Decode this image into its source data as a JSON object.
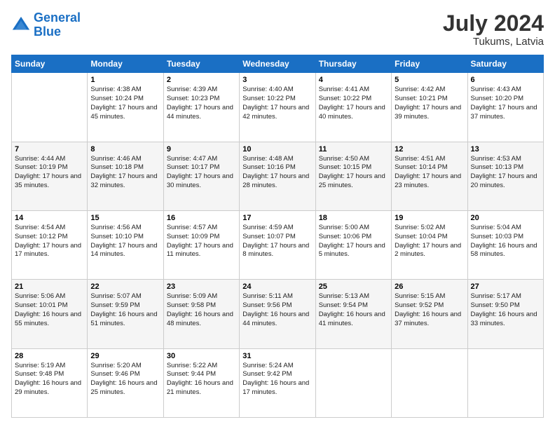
{
  "header": {
    "logo_line1": "General",
    "logo_line2": "Blue",
    "month_year": "July 2024",
    "location": "Tukums, Latvia"
  },
  "weekdays": [
    "Sunday",
    "Monday",
    "Tuesday",
    "Wednesday",
    "Thursday",
    "Friday",
    "Saturday"
  ],
  "weeks": [
    [
      {
        "day": "",
        "info": ""
      },
      {
        "day": "1",
        "info": "Sunrise: 4:38 AM\nSunset: 10:24 PM\nDaylight: 17 hours\nand 45 minutes."
      },
      {
        "day": "2",
        "info": "Sunrise: 4:39 AM\nSunset: 10:23 PM\nDaylight: 17 hours\nand 44 minutes."
      },
      {
        "day": "3",
        "info": "Sunrise: 4:40 AM\nSunset: 10:22 PM\nDaylight: 17 hours\nand 42 minutes."
      },
      {
        "day": "4",
        "info": "Sunrise: 4:41 AM\nSunset: 10:22 PM\nDaylight: 17 hours\nand 40 minutes."
      },
      {
        "day": "5",
        "info": "Sunrise: 4:42 AM\nSunset: 10:21 PM\nDaylight: 17 hours\nand 39 minutes."
      },
      {
        "day": "6",
        "info": "Sunrise: 4:43 AM\nSunset: 10:20 PM\nDaylight: 17 hours\nand 37 minutes."
      }
    ],
    [
      {
        "day": "7",
        "info": "Sunrise: 4:44 AM\nSunset: 10:19 PM\nDaylight: 17 hours\nand 35 minutes."
      },
      {
        "day": "8",
        "info": "Sunrise: 4:46 AM\nSunset: 10:18 PM\nDaylight: 17 hours\nand 32 minutes."
      },
      {
        "day": "9",
        "info": "Sunrise: 4:47 AM\nSunset: 10:17 PM\nDaylight: 17 hours\nand 30 minutes."
      },
      {
        "day": "10",
        "info": "Sunrise: 4:48 AM\nSunset: 10:16 PM\nDaylight: 17 hours\nand 28 minutes."
      },
      {
        "day": "11",
        "info": "Sunrise: 4:50 AM\nSunset: 10:15 PM\nDaylight: 17 hours\nand 25 minutes."
      },
      {
        "day": "12",
        "info": "Sunrise: 4:51 AM\nSunset: 10:14 PM\nDaylight: 17 hours\nand 23 minutes."
      },
      {
        "day": "13",
        "info": "Sunrise: 4:53 AM\nSunset: 10:13 PM\nDaylight: 17 hours\nand 20 minutes."
      }
    ],
    [
      {
        "day": "14",
        "info": "Sunrise: 4:54 AM\nSunset: 10:12 PM\nDaylight: 17 hours\nand 17 minutes."
      },
      {
        "day": "15",
        "info": "Sunrise: 4:56 AM\nSunset: 10:10 PM\nDaylight: 17 hours\nand 14 minutes."
      },
      {
        "day": "16",
        "info": "Sunrise: 4:57 AM\nSunset: 10:09 PM\nDaylight: 17 hours\nand 11 minutes."
      },
      {
        "day": "17",
        "info": "Sunrise: 4:59 AM\nSunset: 10:07 PM\nDaylight: 17 hours\nand 8 minutes."
      },
      {
        "day": "18",
        "info": "Sunrise: 5:00 AM\nSunset: 10:06 PM\nDaylight: 17 hours\nand 5 minutes."
      },
      {
        "day": "19",
        "info": "Sunrise: 5:02 AM\nSunset: 10:04 PM\nDaylight: 17 hours\nand 2 minutes."
      },
      {
        "day": "20",
        "info": "Sunrise: 5:04 AM\nSunset: 10:03 PM\nDaylight: 16 hours\nand 58 minutes."
      }
    ],
    [
      {
        "day": "21",
        "info": "Sunrise: 5:06 AM\nSunset: 10:01 PM\nDaylight: 16 hours\nand 55 minutes."
      },
      {
        "day": "22",
        "info": "Sunrise: 5:07 AM\nSunset: 9:59 PM\nDaylight: 16 hours\nand 51 minutes."
      },
      {
        "day": "23",
        "info": "Sunrise: 5:09 AM\nSunset: 9:58 PM\nDaylight: 16 hours\nand 48 minutes."
      },
      {
        "day": "24",
        "info": "Sunrise: 5:11 AM\nSunset: 9:56 PM\nDaylight: 16 hours\nand 44 minutes."
      },
      {
        "day": "25",
        "info": "Sunrise: 5:13 AM\nSunset: 9:54 PM\nDaylight: 16 hours\nand 41 minutes."
      },
      {
        "day": "26",
        "info": "Sunrise: 5:15 AM\nSunset: 9:52 PM\nDaylight: 16 hours\nand 37 minutes."
      },
      {
        "day": "27",
        "info": "Sunrise: 5:17 AM\nSunset: 9:50 PM\nDaylight: 16 hours\nand 33 minutes."
      }
    ],
    [
      {
        "day": "28",
        "info": "Sunrise: 5:19 AM\nSunset: 9:48 PM\nDaylight: 16 hours\nand 29 minutes."
      },
      {
        "day": "29",
        "info": "Sunrise: 5:20 AM\nSunset: 9:46 PM\nDaylight: 16 hours\nand 25 minutes."
      },
      {
        "day": "30",
        "info": "Sunrise: 5:22 AM\nSunset: 9:44 PM\nDaylight: 16 hours\nand 21 minutes."
      },
      {
        "day": "31",
        "info": "Sunrise: 5:24 AM\nSunset: 9:42 PM\nDaylight: 16 hours\nand 17 minutes."
      },
      {
        "day": "",
        "info": ""
      },
      {
        "day": "",
        "info": ""
      },
      {
        "day": "",
        "info": ""
      }
    ]
  ]
}
